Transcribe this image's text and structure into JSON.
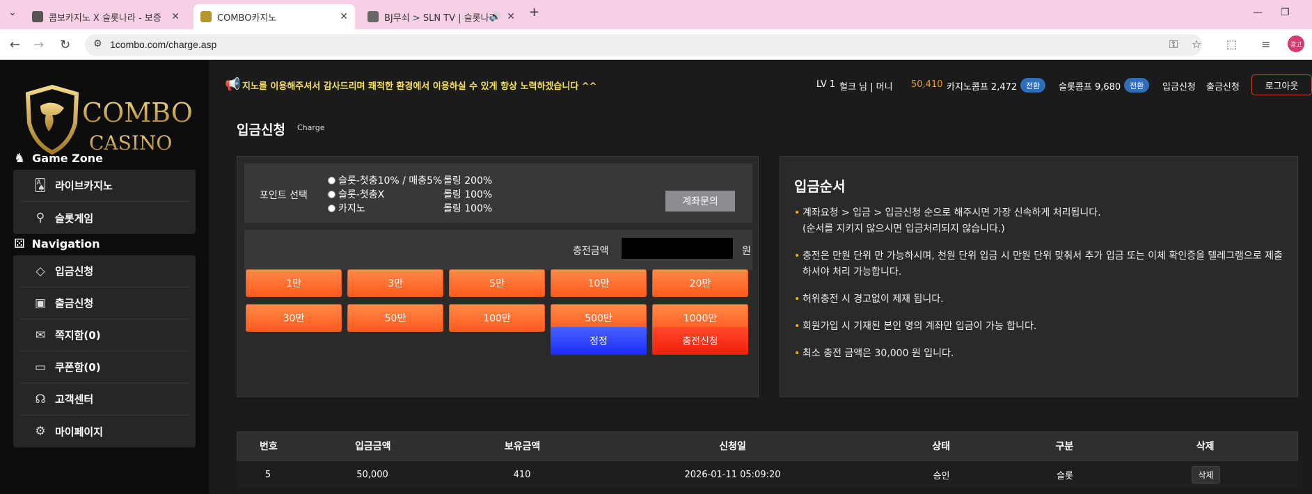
{
  "browser": {
    "tabs": [
      {
        "title": "콤보카지노 X 슬롯나라 - 보증"
      },
      {
        "title": "COMBO카지노"
      },
      {
        "title": "BJ무쇠 > SLN TV | 슬롯나라"
      }
    ],
    "url": "1combo.com/charge.asp",
    "profile": "광고"
  },
  "sidebar": {
    "logo_top": "COMBO",
    "logo_bottom": "CASINO",
    "game_zone_title": "Game Zone",
    "game_items": [
      {
        "label": "라이브카지노",
        "icon": "cards-icon"
      },
      {
        "label": "슬롯게임",
        "icon": "joystick-icon"
      }
    ],
    "navigation_title": "Navigation",
    "nav_items": [
      {
        "label": "입금신청",
        "icon": "diamond-icon"
      },
      {
        "label": "출금신청",
        "icon": "wallet-icon"
      },
      {
        "label": "쪽지함(0)",
        "icon": "mail-icon"
      },
      {
        "label": "쿠폰함(0)",
        "icon": "card-icon"
      },
      {
        "label": "고객센터",
        "icon": "headset-icon"
      },
      {
        "label": "마이페이지",
        "icon": "gear-icon"
      }
    ]
  },
  "topbar": {
    "marquee": "지노를 이용해주셔서 감사드리며 쾌적한 환경에서 이용하실 수 있게 항상 노력하겠습니다 ^^",
    "level": "LV 1",
    "user": "헐크 님 | 머니",
    "money": "50,410",
    "casino_comp": "카지노콤프 2,472",
    "slot_comp": "슬롯콤프 9,680",
    "swap_label": "전환",
    "deposit_link": "입금신청",
    "withdraw_link": "출금신청",
    "logout": "로그아웃"
  },
  "page": {
    "title": "입금신청",
    "subtitle": "Charge"
  },
  "form": {
    "point_label": "포인트 선택",
    "options": [
      {
        "label": "슬롯-첫충10% / 매충5%",
        "rolling": "롤링 200%"
      },
      {
        "label": "슬롯-첫충X",
        "rolling": "롤링 100%"
      },
      {
        "label": "카지노",
        "rolling": "롤링 100%"
      }
    ],
    "inquiry_button": "계좌문의",
    "amount_label": "충전금액",
    "amount_value": "",
    "won": "원",
    "amount_buttons": [
      "1만",
      "3만",
      "5만",
      "10만",
      "20만",
      "30만",
      "50만",
      "100만",
      "500만",
      "1000만"
    ],
    "reset_button": "정정",
    "submit_button": "충전신청"
  },
  "guide": {
    "title": "입금순서",
    "items": [
      "계좌요청 > 입금 > 입금신청 순으로 해주시면 가장 신속하게 처리됩니다.\n(순서를 지키지 않으시면 입금처리되지 않습니다.)",
      "충전은 만원 단위 만 가능하시며, 천원 단위 입금 시 만원 단위 맞춰서 추가 입금 또는 이체 확인증을 텔레그램으로 제출 하셔야 처리 가능합니다.",
      "허위충전 시 경고없이 제재 됩니다.",
      "회원가입 시 기재된 본인 명의 계좌만 입금이 가능 합니다.",
      "최소 충전 금액은 30,000 원 입니다."
    ]
  },
  "table": {
    "headers": [
      "번호",
      "입금금액",
      "보유금액",
      "신청일",
      "상태",
      "구분",
      "삭제"
    ],
    "rows": [
      {
        "no": "5",
        "amount": "50,000",
        "balance": "410",
        "date": "2026-01-11 05:09:20",
        "status": "승인",
        "type": "슬롯",
        "delete": "삭제"
      }
    ]
  },
  "colors": {
    "accent_orange": "#ff6a2a",
    "money": "#f29a1d",
    "marquee": "#f5e15a",
    "swap_blue": "#2f6fb9"
  }
}
